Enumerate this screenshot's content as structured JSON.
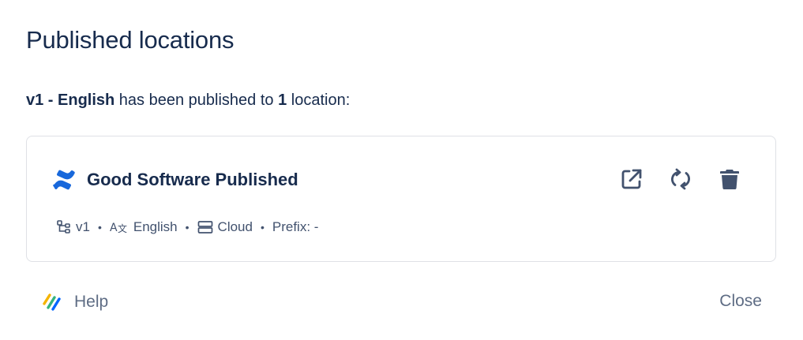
{
  "dialog": {
    "title": "Published locations",
    "summary": {
      "version_language": "v1 - English",
      "middle_text": " has been published to ",
      "count": "1",
      "end_text": " location:"
    }
  },
  "location": {
    "name": "Good Software Published",
    "icon": "confluence-icon",
    "actions": {
      "open": "external-link-icon",
      "sync": "sync-icon",
      "delete": "trash-icon"
    },
    "meta": {
      "version": "v1",
      "language": "English",
      "platform": "Cloud",
      "prefix": "Prefix: -"
    }
  },
  "footer": {
    "help_label": "Help",
    "close_label": "Close"
  },
  "colors": {
    "text": "#172B4D",
    "subtle": "#42526E",
    "muted": "#5E6C84",
    "confluence_blue": "#1868DB",
    "border": "#DFE1E6"
  }
}
